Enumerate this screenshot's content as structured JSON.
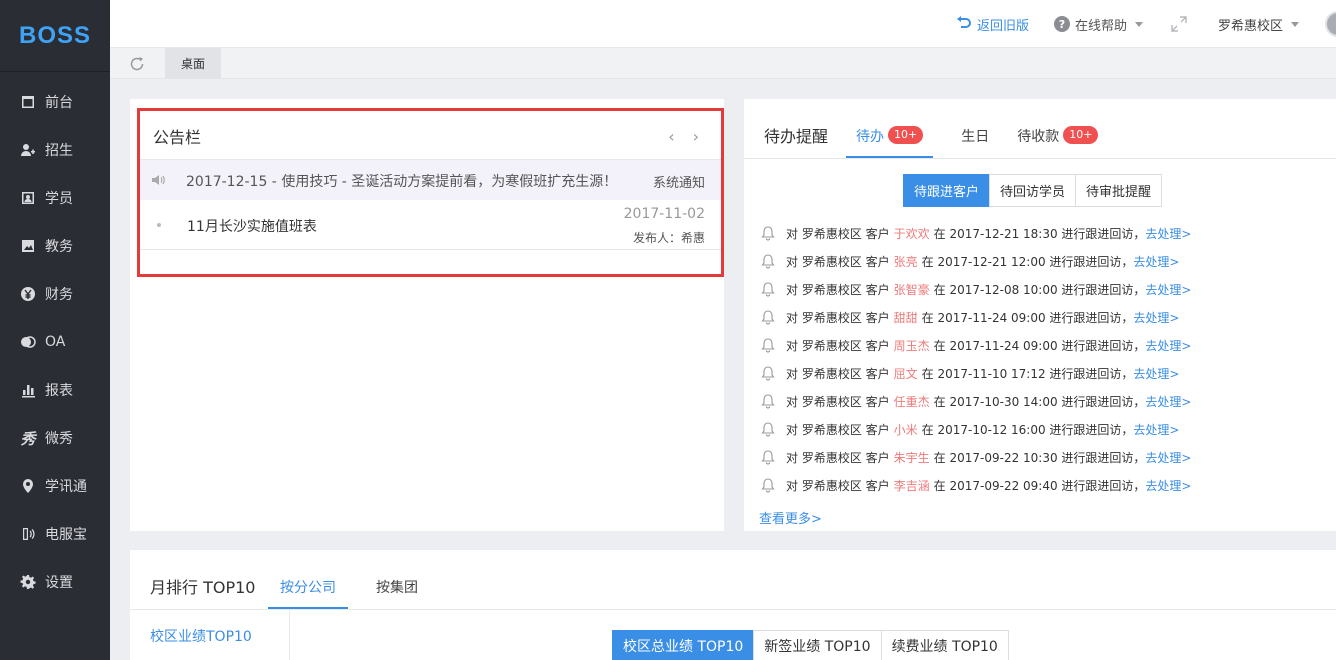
{
  "sidebar": {
    "logo": "BOSS",
    "items": [
      {
        "label": "前台",
        "icon": "desk-icon"
      },
      {
        "label": "招生",
        "icon": "add-user-icon"
      },
      {
        "label": "学员",
        "icon": "student-icon"
      },
      {
        "label": "教务",
        "icon": "teaching-icon"
      },
      {
        "label": "财务",
        "icon": "yen-icon"
      },
      {
        "label": "OA",
        "icon": "oa-icon"
      },
      {
        "label": "报表",
        "icon": "bar-chart-icon"
      },
      {
        "label": "微秀",
        "icon": "weixiu-icon"
      },
      {
        "label": "学讯通",
        "icon": "location-pin-icon"
      },
      {
        "label": "电服宝",
        "icon": "phone-icon"
      },
      {
        "label": "设置",
        "icon": "gear-icon"
      }
    ]
  },
  "header": {
    "old_version": "返回旧版",
    "help": "在线帮助",
    "campus": "罗希惠校区"
  },
  "tabbar": {
    "active_tab": "桌面"
  },
  "notice": {
    "title": "公告栏",
    "items": [
      {
        "text": "2017-12-15 - 使用技巧 - 圣诞活动方案提前看，为寒假班扩充生源！",
        "tag": "系统通知"
      },
      {
        "text": "11月长沙实施值班表",
        "date": "2017-11-02",
        "publisher": "发布人：希惠"
      }
    ]
  },
  "todo": {
    "title": "待办提醒",
    "tabs": [
      {
        "label": "待办",
        "badge": "10+"
      },
      {
        "label": "生日",
        "badge": ""
      },
      {
        "label": "待收款",
        "badge": "10+"
      }
    ],
    "segments": [
      "待跟进客户",
      "待回访学员",
      "待审批提醒"
    ],
    "reminders": [
      {
        "prefix": "对 罗希惠校区 客户",
        "name": "于欢欢",
        "time": "在 2017-12-21 18:30 进行跟进回访，",
        "action": "去处理>"
      },
      {
        "prefix": "对 罗希惠校区 客户",
        "name": "张亮",
        "time": "在 2017-12-21 12:00 进行跟进回访，",
        "action": "去处理>"
      },
      {
        "prefix": "对 罗希惠校区 客户",
        "name": "张智豪",
        "time": "在 2017-12-08 10:00 进行跟进回访，",
        "action": "去处理>"
      },
      {
        "prefix": "对 罗希惠校区 客户",
        "name": "甜甜",
        "time": "在 2017-11-24 09:00 进行跟进回访，",
        "action": "去处理>"
      },
      {
        "prefix": "对 罗希惠校区 客户",
        "name": "周玉杰",
        "time": "在 2017-11-24 09:00 进行跟进回访，",
        "action": "去处理>"
      },
      {
        "prefix": "对 罗希惠校区 客户",
        "name": "屈文",
        "time": "在 2017-11-10 17:12 进行跟进回访，",
        "action": "去处理>"
      },
      {
        "prefix": "对 罗希惠校区 客户",
        "name": "任重杰",
        "time": "在 2017-10-30 14:00 进行跟进回访，",
        "action": "去处理>"
      },
      {
        "prefix": "对 罗希惠校区 客户",
        "name": "小米",
        "time": "在 2017-10-12 16:00 进行跟进回访，",
        "action": "去处理>"
      },
      {
        "prefix": "对 罗希惠校区 客户",
        "name": "朱宇生",
        "time": "在 2017-09-22 10:30 进行跟进回访，",
        "action": "去处理>"
      },
      {
        "prefix": "对 罗希惠校区 客户",
        "name": "李吉涵",
        "time": "在 2017-09-22 09:40 进行跟进回访，",
        "action": "去处理>"
      }
    ],
    "more": "查看更多>"
  },
  "rank": {
    "title": "月排行 TOP10",
    "tabs": [
      "按分公司",
      "按集团"
    ],
    "left_item": "校区业绩TOP10",
    "segments": [
      "校区总业绩 TOP10",
      "新签业绩 TOP10",
      "续费业绩 TOP10"
    ]
  },
  "colors": {
    "accent": "#3a8ee6",
    "sidebar_bg": "#2b2d34",
    "badge": "#f05050",
    "highlight_border": "#e33b3b",
    "customer_name": "#ef7a7a"
  }
}
